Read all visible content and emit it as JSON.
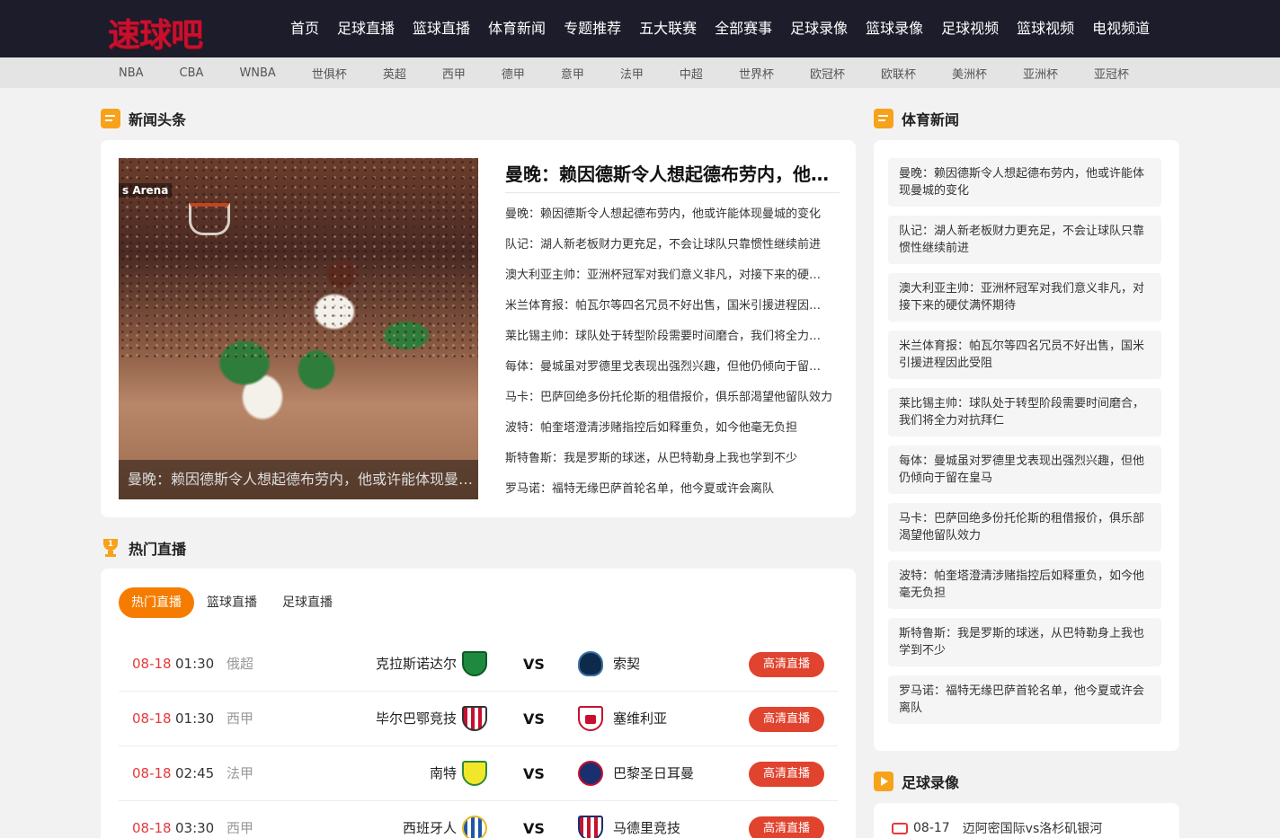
{
  "brand": {
    "logo_text": "速球吧"
  },
  "main_nav": [
    "首页",
    "足球直播",
    "篮球直播",
    "体育新闻",
    "专题推荐",
    "五大联赛",
    "全部赛事",
    "足球录像",
    "篮球录像",
    "足球视频",
    "篮球视频",
    "电视频道"
  ],
  "sub_nav": [
    "NBA",
    "CBA",
    "WNBA",
    "世俱杯",
    "英超",
    "西甲",
    "德甲",
    "意甲",
    "法甲",
    "中超",
    "世界杯",
    "欧冠杯",
    "欧联杯",
    "美洲杯",
    "亚洲杯",
    "亚冠杯"
  ],
  "headlines_section": {
    "title": "新闻头条",
    "hero_arena_text": "s Arena",
    "hero_caption": "曼晚：赖因德斯令人想起德布劳内，他或许能体现曼城的变化",
    "headline": "曼晚：赖因德斯令人想起德布劳内，他或许能体现曼城的变化",
    "items": [
      "曼晚：赖因德斯令人想起德布劳内，他或许能体现曼城的变化",
      "队记：湖人新老板财力更充足，不会让球队只靠惯性继续前进",
      "澳大利亚主帅：亚洲杯冠军对我们意义非凡，对接下来的硬仗满怀期待",
      "米兰体育报：帕瓦尔等四名冗员不好出售，国米引援进程因此受阻",
      "莱比锡主帅：球队处于转型阶段需要时间磨合，我们将全力对抗拜仁",
      "每体：曼城虽对罗德里戈表现出强烈兴趣，但他仍倾向于留在皇马",
      "马卡：巴萨回绝多份托伦斯的租借报价，俱乐部渴望他留队效力",
      "波特：帕奎塔澄清涉赌指控后如释重负，如今他毫无负担",
      "斯特鲁斯：我是罗斯的球迷，从巴特勒身上我也学到不少",
      "罗马诺：福特无缘巴萨首轮名单，他今夏或许会离队"
    ]
  },
  "live_section": {
    "title": "热门直播",
    "tabs": [
      "热门直播",
      "篮球直播",
      "足球直播"
    ],
    "matches": [
      {
        "date": "08-18",
        "time": "01:30",
        "league": "俄超",
        "home": "克拉斯诺达尔",
        "away": "索契",
        "button": "高清直播"
      },
      {
        "date": "08-18",
        "time": "01:30",
        "league": "西甲",
        "home": "毕尔巴鄂竞技",
        "away": "塞维利亚",
        "button": "高清直播"
      },
      {
        "date": "08-18",
        "time": "02:45",
        "league": "法甲",
        "home": "南特",
        "away": "巴黎圣日耳曼",
        "button": "高清直播"
      },
      {
        "date": "08-18",
        "time": "03:30",
        "league": "西甲",
        "home": "西班牙人",
        "away": "马德里竞技",
        "button": "高清直播"
      }
    ],
    "vs_label": "VS",
    "logos": {
      "home": [
        "shield-green",
        "ball-badge-blue",
        "striped-shield",
        "yellow-shield"
      ],
      "away": [
        "ball-badge-blue",
        "red-white-shield",
        "psg-round",
        "striped-shield"
      ]
    }
  },
  "sports_news_section": {
    "title": "体育新闻",
    "items": [
      "曼晚：赖因德斯令人想起德布劳内，他或许能体现曼城的变化",
      "队记：湖人新老板财力更充足，不会让球队只靠惯性继续前进",
      "澳大利亚主帅：亚洲杯冠军对我们意义非凡，对接下来的硬仗满怀期待",
      "米兰体育报：帕瓦尔等四名冗员不好出售，国米引援进程因此受阻",
      "莱比锡主帅：球队处于转型阶段需要时间磨合，我们将全力对抗拜仁",
      "每体：曼城虽对罗德里戈表现出强烈兴趣，但他仍倾向于留在皇马",
      "马卡：巴萨回绝多份托伦斯的租借报价，俱乐部渴望他留队效力",
      "波特：帕奎塔澄清涉赌指控后如释重负，如今他毫无负担",
      "斯特鲁斯：我是罗斯的球迷，从巴特勒身上我也学到不少",
      "罗马诺：福特无缘巴萨首轮名单，他今夏或许会离队"
    ]
  },
  "football_video_section": {
    "title": "足球录像",
    "first_item": {
      "date": "08-17",
      "title": "迈阿密国际vs洛杉矶银河"
    }
  },
  "colors": {
    "topbar": "#1c1c2b",
    "accent": "#f57c00",
    "live_button": "#e0432e",
    "date_red": "#e4393c",
    "section_icon": "#f7a21b"
  }
}
